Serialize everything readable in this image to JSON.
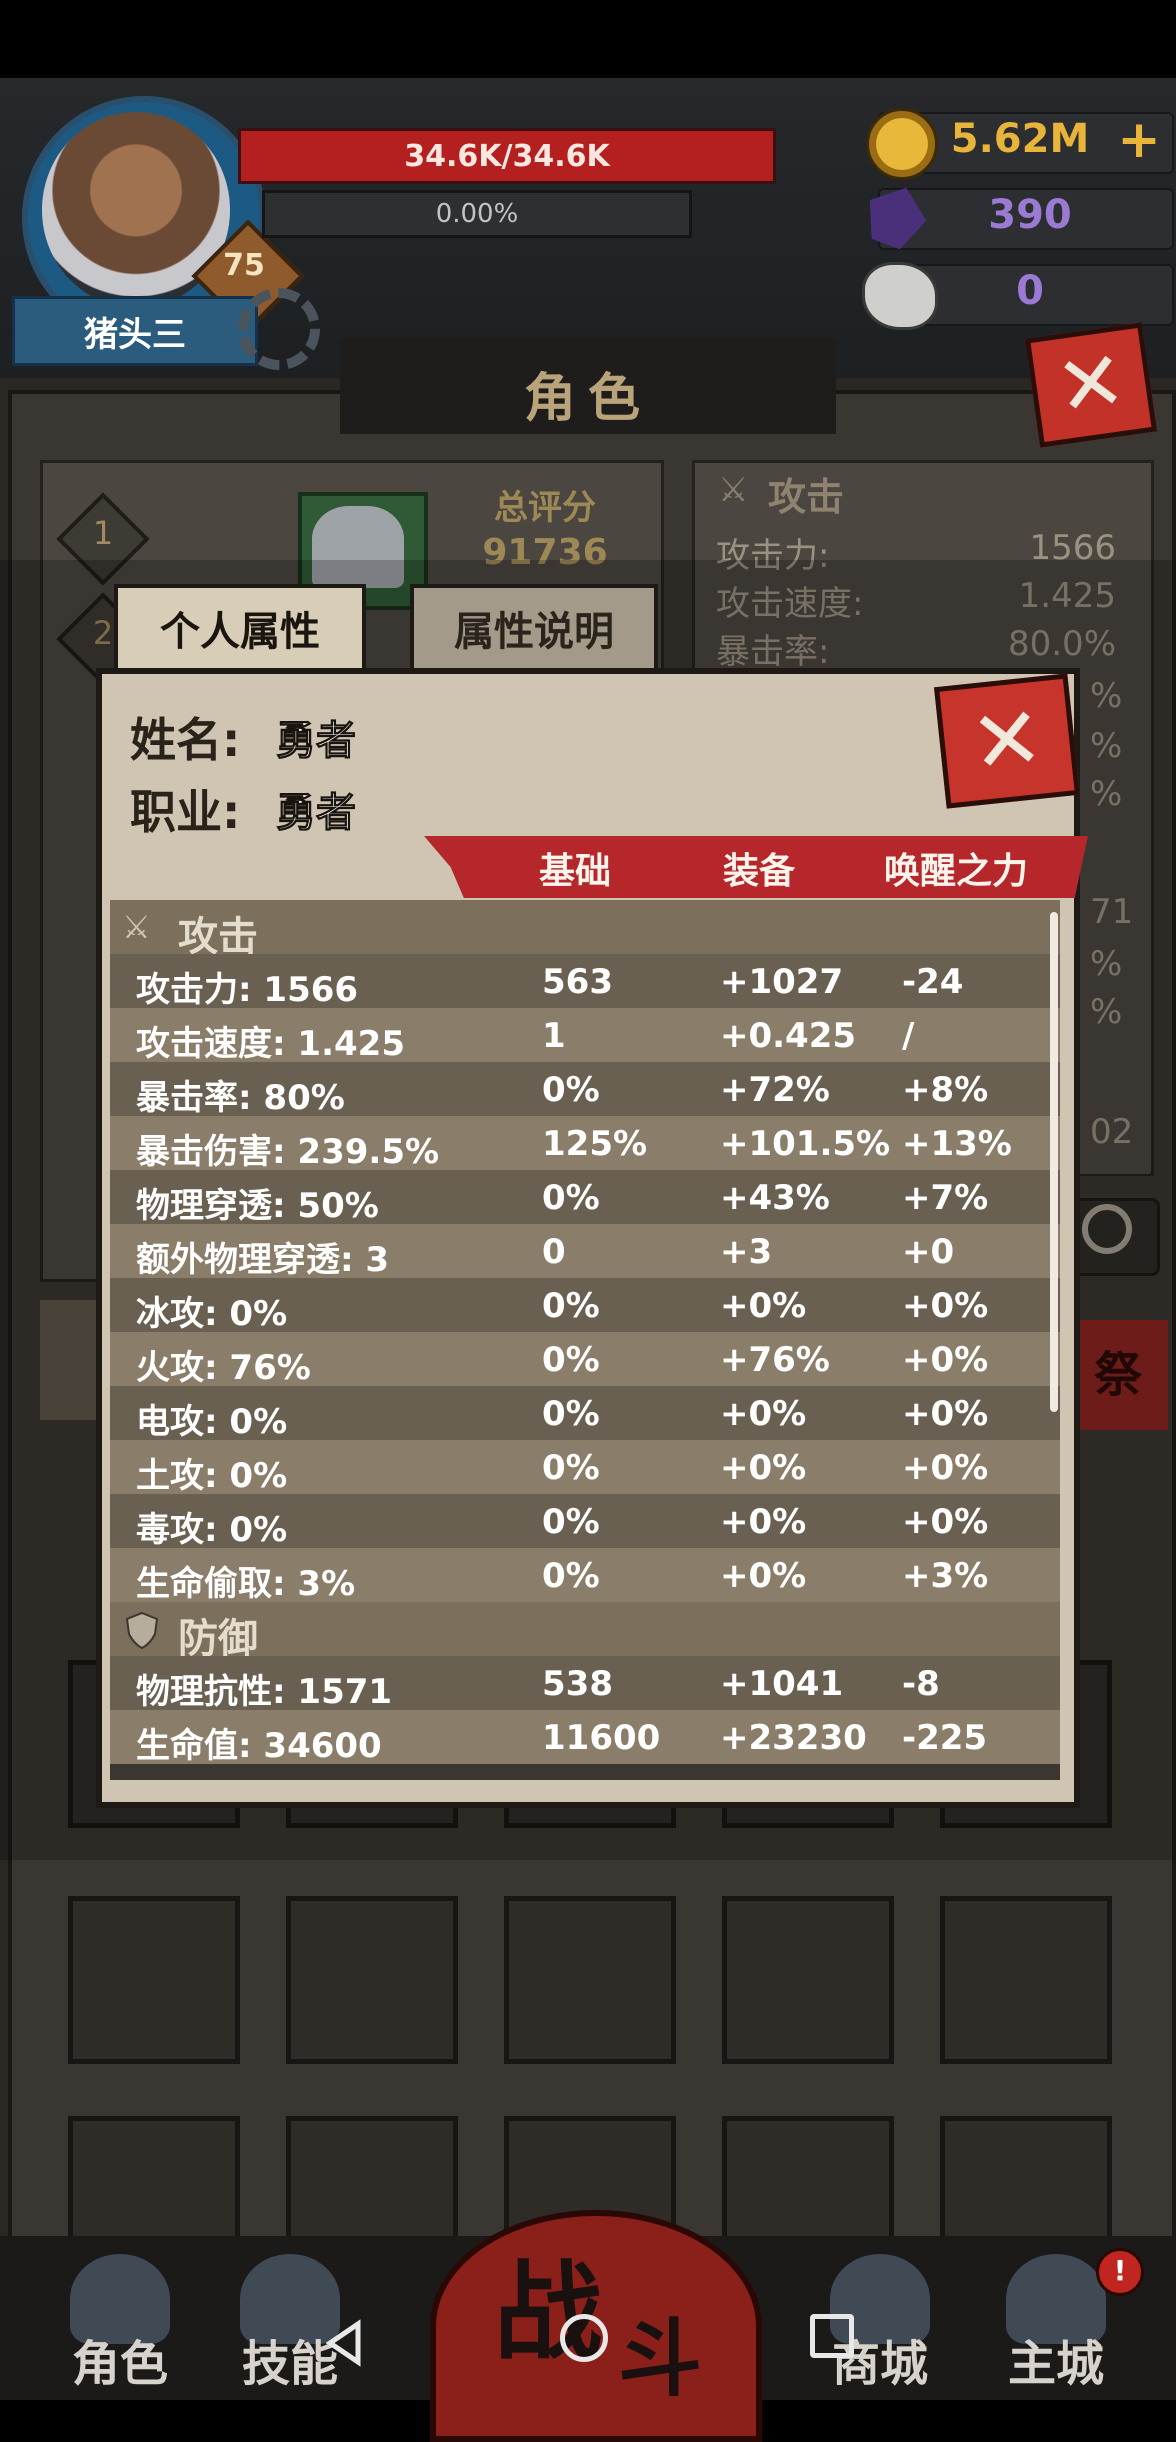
{
  "header": {
    "player_name": "猪头三",
    "level": "75",
    "hp_text": "34.6K/34.6K",
    "exp_text": "0.00%",
    "gold": "5.62M",
    "gold_plus": "+",
    "gems": "390",
    "horns": "0",
    "close": "✕"
  },
  "page_title": "角色",
  "background": {
    "slot_numbers": [
      "1",
      "2"
    ],
    "score_label": "总评分",
    "score_value": "91736",
    "attack_section": "攻击",
    "attack_rows": [
      {
        "k": "攻击力:",
        "v": "1566"
      },
      {
        "k": "攻击速度:",
        "v": "1.425"
      },
      {
        "k": "暴击率:",
        "v": "80.0%"
      }
    ],
    "clipped_values": [
      "%",
      "%",
      "%",
      "71",
      "%",
      "%",
      "02"
    ],
    "sacrifice_label": "祭"
  },
  "dialog": {
    "tabs": [
      "个人属性",
      "属性说明"
    ],
    "name_label": "姓名:",
    "name_value": "勇者",
    "job_label": "职业:",
    "job_value": "勇者",
    "close": "✕",
    "columns": [
      "基础",
      "装备",
      "唤醒之力"
    ],
    "sections": {
      "attack": "攻击",
      "defense": "防御"
    },
    "attack_rows": [
      [
        "攻击力: 1566",
        "563",
        "+1027",
        "-24"
      ],
      [
        "攻击速度: 1.425",
        "1",
        "+0.425",
        "/"
      ],
      [
        "暴击率: 80%",
        "0%",
        "+72%",
        "+8%"
      ],
      [
        "暴击伤害: 239.5%",
        "125%",
        "+101.5%",
        "+13%"
      ],
      [
        "物理穿透: 50%",
        "0%",
        "+43%",
        "+7%"
      ],
      [
        "额外物理穿透: 3",
        "0",
        "+3",
        "+0"
      ],
      [
        "冰攻: 0%",
        "0%",
        "+0%",
        "+0%"
      ],
      [
        "火攻: 76%",
        "0%",
        "+76%",
        "+0%"
      ],
      [
        "电攻: 0%",
        "0%",
        "+0%",
        "+0%"
      ],
      [
        "土攻: 0%",
        "0%",
        "+0%",
        "+0%"
      ],
      [
        "毒攻: 0%",
        "0%",
        "+0%",
        "+0%"
      ],
      [
        "生命偷取: 3%",
        "0%",
        "+0%",
        "+3%"
      ]
    ],
    "defense_rows": [
      [
        "物理抗性: 1571",
        "538",
        "+1041",
        "-8"
      ],
      [
        "生命值: 34600",
        "11600",
        "+23230",
        "-225"
      ]
    ]
  },
  "nav": {
    "role": "角色",
    "skills": "技能",
    "fight_1": "战",
    "fight_2": "斗",
    "shop": "商城",
    "city": "主城",
    "alert": "!"
  },
  "colors": {
    "hp_red": "#b3201f",
    "gold": "#e8b43a",
    "gem_purple": "#9a7ad2",
    "ribbon_red": "#b5272a"
  },
  "icons": [
    "gear-icon",
    "gold-coin-icon",
    "gem-icon",
    "ram-horn-icon",
    "close-icon",
    "sword-icon",
    "shield-icon",
    "search-icon"
  ]
}
